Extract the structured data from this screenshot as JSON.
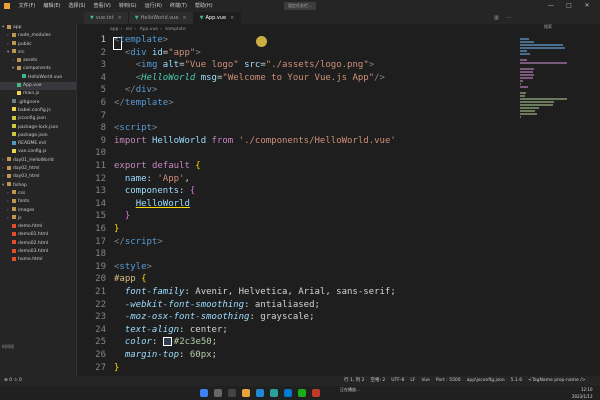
{
  "menubar": {
    "items": [
      "文件(F)",
      "编辑(E)",
      "选择(S)",
      "查看(V)",
      "转到(G)",
      "运行(R)",
      "终端(T)",
      "帮助(H)"
    ],
    "float_label": "固定任务栏..."
  },
  "tabs": [
    {
      "label": "vue.txt",
      "active": false
    },
    {
      "label": "HelloWorld.vue",
      "active": false
    },
    {
      "label": "App.vue",
      "active": true
    }
  ],
  "right_panel_title": "搜索",
  "breadcrumb": {
    "path": [
      "app",
      "src"
    ],
    "file": "App.vue",
    "node": "template"
  },
  "sidebar": {
    "rows": [
      {
        "indent": 0,
        "twisty": "▾",
        "label": "app",
        "icon": "folder",
        "color": "#c09553"
      },
      {
        "indent": 1,
        "twisty": "›",
        "label": "node_modules",
        "icon": "folder",
        "color": "#c09553"
      },
      {
        "indent": 1,
        "twisty": "›",
        "label": "public",
        "icon": "folder",
        "color": "#c09553"
      },
      {
        "indent": 1,
        "twisty": "▾",
        "label": "src",
        "icon": "folder",
        "color": "#c09553"
      },
      {
        "indent": 2,
        "twisty": "›",
        "label": "assets",
        "icon": "folder",
        "color": "#c09553"
      },
      {
        "indent": 2,
        "twisty": "▾",
        "label": "components",
        "icon": "folder",
        "color": "#c09553"
      },
      {
        "indent": 3,
        "twisty": "",
        "label": "HelloWorld.vue",
        "icon": "vue",
        "color": "#41b883"
      },
      {
        "indent": 2,
        "twisty": "",
        "label": "App.vue",
        "icon": "vue",
        "color": "#41b883",
        "selected": true
      },
      {
        "indent": 2,
        "twisty": "",
        "label": "main.js",
        "icon": "js",
        "color": "#e8d44d"
      },
      {
        "indent": 1,
        "twisty": "",
        "label": ".gitignore",
        "icon": "file",
        "color": "#6d8086"
      },
      {
        "indent": 1,
        "twisty": "",
        "label": "babel.config.js",
        "icon": "js",
        "color": "#e8d44d"
      },
      {
        "indent": 1,
        "twisty": "",
        "label": "jsconfig.json",
        "icon": "json",
        "color": "#cbcb41"
      },
      {
        "indent": 1,
        "twisty": "",
        "label": "package-lock.json",
        "icon": "json",
        "color": "#cbcb41"
      },
      {
        "indent": 1,
        "twisty": "",
        "label": "package.json",
        "icon": "json",
        "color": "#cbcb41"
      },
      {
        "indent": 1,
        "twisty": "",
        "label": "README.md",
        "icon": "md",
        "color": "#519aba"
      },
      {
        "indent": 1,
        "twisty": "",
        "label": "vue.config.js",
        "icon": "js",
        "color": "#e8d44d"
      },
      {
        "indent": 0,
        "twisty": "›",
        "label": "day01_HelloWorld",
        "icon": "folder",
        "color": "#c09553"
      },
      {
        "indent": 0,
        "twisty": "›",
        "label": "day02_html",
        "icon": "folder",
        "color": "#c09553"
      },
      {
        "indent": 0,
        "twisty": "›",
        "label": "day03_html",
        "icon": "folder",
        "color": "#c09553"
      },
      {
        "indent": 0,
        "twisty": "▾",
        "label": "tishop",
        "icon": "folder",
        "color": "#c09553"
      },
      {
        "indent": 1,
        "twisty": "›",
        "label": "css",
        "icon": "folder",
        "color": "#c09553"
      },
      {
        "indent": 1,
        "twisty": "›",
        "label": "fonts",
        "icon": "folder",
        "color": "#c09553"
      },
      {
        "indent": 1,
        "twisty": "›",
        "label": "images",
        "icon": "folder",
        "color": "#c09553"
      },
      {
        "indent": 1,
        "twisty": "›",
        "label": "js",
        "icon": "folder",
        "color": "#c09553"
      },
      {
        "indent": 1,
        "twisty": "",
        "label": "demo.html",
        "icon": "html",
        "color": "#e44d26"
      },
      {
        "indent": 1,
        "twisty": "",
        "label": "demo01.html",
        "icon": "html",
        "color": "#e44d26"
      },
      {
        "indent": 1,
        "twisty": "",
        "label": "demo02.html",
        "icon": "html",
        "color": "#e44d26"
      },
      {
        "indent": 1,
        "twisty": "",
        "label": "demo03.html",
        "icon": "html",
        "color": "#e44d26"
      },
      {
        "indent": 1,
        "twisty": "",
        "label": "home.html",
        "icon": "html",
        "color": "#e44d26"
      }
    ],
    "bottom_label": "时间线"
  },
  "editor": {
    "current_line": 1,
    "lines": [
      {
        "n": 1,
        "tokens": [
          [
            "t-punc",
            "<"
          ],
          [
            "t-tag",
            "template"
          ],
          [
            "t-punc",
            ">"
          ]
        ]
      },
      {
        "n": 2,
        "tokens": [
          [
            "t-plain",
            "  "
          ],
          [
            "t-punc",
            "<"
          ],
          [
            "t-tag",
            "div"
          ],
          [
            "t-plain",
            " "
          ],
          [
            "t-attr",
            "id"
          ],
          [
            "t-plain",
            "="
          ],
          [
            "t-str",
            "\"app\""
          ],
          [
            "t-punc",
            ">"
          ]
        ]
      },
      {
        "n": 3,
        "tokens": [
          [
            "t-plain",
            "    "
          ],
          [
            "t-punc",
            "<"
          ],
          [
            "t-tag",
            "img"
          ],
          [
            "t-plain",
            " "
          ],
          [
            "t-attr",
            "alt"
          ],
          [
            "t-plain",
            "="
          ],
          [
            "t-str",
            "\"Vue logo\""
          ],
          [
            "t-plain",
            " "
          ],
          [
            "t-attr",
            "src"
          ],
          [
            "t-plain",
            "="
          ],
          [
            "t-str",
            "\"./assets/logo.png\""
          ],
          [
            "t-punc",
            ">"
          ]
        ]
      },
      {
        "n": 4,
        "tokens": [
          [
            "t-plain",
            "    "
          ],
          [
            "t-punc",
            "<"
          ],
          [
            "t-comp",
            "HelloWorld"
          ],
          [
            "t-plain",
            " "
          ],
          [
            "t-attr",
            "msg"
          ],
          [
            "t-plain",
            "="
          ],
          [
            "t-str",
            "\"Welcome to Your Vue.js App\""
          ],
          [
            "t-punc",
            "/>"
          ]
        ]
      },
      {
        "n": 5,
        "tokens": [
          [
            "t-plain",
            "  "
          ],
          [
            "t-punc",
            "</"
          ],
          [
            "t-tag",
            "div"
          ],
          [
            "t-punc",
            ">"
          ]
        ]
      },
      {
        "n": 6,
        "tokens": [
          [
            "t-punc",
            "</"
          ],
          [
            "t-tag",
            "template"
          ],
          [
            "t-punc",
            ">"
          ]
        ]
      },
      {
        "n": 7,
        "tokens": []
      },
      {
        "n": 8,
        "tokens": [
          [
            "t-punc",
            "<"
          ],
          [
            "t-tag",
            "script"
          ],
          [
            "t-punc",
            ">"
          ]
        ]
      },
      {
        "n": 9,
        "tokens": [
          [
            "t-kw",
            "import"
          ],
          [
            "t-plain",
            " "
          ],
          [
            "t-attr",
            "HelloWorld"
          ],
          [
            "t-plain",
            " "
          ],
          [
            "t-kw",
            "from"
          ],
          [
            "t-plain",
            " "
          ],
          [
            "t-str",
            "'./components/HelloWorld.vue'"
          ]
        ]
      },
      {
        "n": 10,
        "tokens": []
      },
      {
        "n": 11,
        "tokens": [
          [
            "t-kw",
            "export"
          ],
          [
            "t-plain",
            " "
          ],
          [
            "t-kw",
            "default"
          ],
          [
            "t-plain",
            " "
          ],
          [
            "t-brace",
            "{"
          ]
        ]
      },
      {
        "n": 12,
        "tokens": [
          [
            "t-plain",
            "  "
          ],
          [
            "t-attr",
            "name"
          ],
          [
            "t-plain",
            ": "
          ],
          [
            "t-str",
            "'App'"
          ],
          [
            "t-plain",
            ","
          ]
        ]
      },
      {
        "n": 13,
        "tokens": [
          [
            "t-plain",
            "  "
          ],
          [
            "t-attr",
            "components"
          ],
          [
            "t-plain",
            ": "
          ],
          [
            "t-brace2",
            "{"
          ]
        ]
      },
      {
        "n": 14,
        "tokens": [
          [
            "t-plain",
            "    "
          ],
          [
            "t-attr under",
            "HelloWorld"
          ]
        ]
      },
      {
        "n": 15,
        "tokens": [
          [
            "t-plain",
            "  "
          ],
          [
            "t-brace2",
            "}"
          ]
        ]
      },
      {
        "n": 16,
        "tokens": [
          [
            "t-brace",
            "}"
          ]
        ]
      },
      {
        "n": 17,
        "tokens": [
          [
            "t-punc",
            "</"
          ],
          [
            "t-tag",
            "script"
          ],
          [
            "t-punc",
            ">"
          ]
        ]
      },
      {
        "n": 18,
        "tokens": []
      },
      {
        "n": 19,
        "tokens": [
          [
            "t-punc",
            "<"
          ],
          [
            "t-tag",
            "style"
          ],
          [
            "t-punc",
            ">"
          ]
        ]
      },
      {
        "n": 20,
        "tokens": [
          [
            "t-sel",
            "#app"
          ],
          [
            "t-plain",
            " "
          ],
          [
            "t-brace",
            "{"
          ]
        ]
      },
      {
        "n": 21,
        "tokens": [
          [
            "t-plain",
            "  "
          ],
          [
            "t-prop",
            "font-family"
          ],
          [
            "t-plain",
            ": Avenir, Helvetica, Arial, sans-serif;"
          ]
        ]
      },
      {
        "n": 22,
        "tokens": [
          [
            "t-plain",
            "  "
          ],
          [
            "t-prop",
            "-webkit-font-smoothing"
          ],
          [
            "t-plain",
            ": antialiased;"
          ]
        ]
      },
      {
        "n": 23,
        "tokens": [
          [
            "t-plain",
            "  "
          ],
          [
            "t-prop",
            "-moz-osx-font-smoothing"
          ],
          [
            "t-plain",
            ": grayscale;"
          ]
        ]
      },
      {
        "n": 24,
        "tokens": [
          [
            "t-plain",
            "  "
          ],
          [
            "t-prop",
            "text-align"
          ],
          [
            "t-plain",
            ": center;"
          ]
        ]
      },
      {
        "n": 25,
        "tokens": [
          [
            "t-plain",
            "  "
          ],
          [
            "t-prop",
            "color"
          ],
          [
            "t-plain",
            ": "
          ],
          [
            "swatch",
            ""
          ],
          [
            "t-num",
            "#2c3e50"
          ],
          [
            "t-plain",
            ";"
          ]
        ]
      },
      {
        "n": 26,
        "tokens": [
          [
            "t-plain",
            "  "
          ],
          [
            "t-prop",
            "margin-top"
          ],
          [
            "t-plain",
            ": "
          ],
          [
            "t-num",
            "60px"
          ],
          [
            "t-plain",
            ";"
          ]
        ]
      },
      {
        "n": 27,
        "tokens": [
          [
            "t-brace",
            "}"
          ]
        ]
      }
    ]
  },
  "statusbar": {
    "right": [
      "行 1, 列 2",
      "空格: 2",
      "UTF-8",
      "LF",
      "Vue",
      "Port : 5500",
      "app\\jsconfig.json",
      "5.1.6",
      "<TagName prop-name />"
    ]
  },
  "taskbar": {
    "notification": "正在播放...",
    "clock_time": "12:10",
    "clock_date": "2023/1/13"
  }
}
